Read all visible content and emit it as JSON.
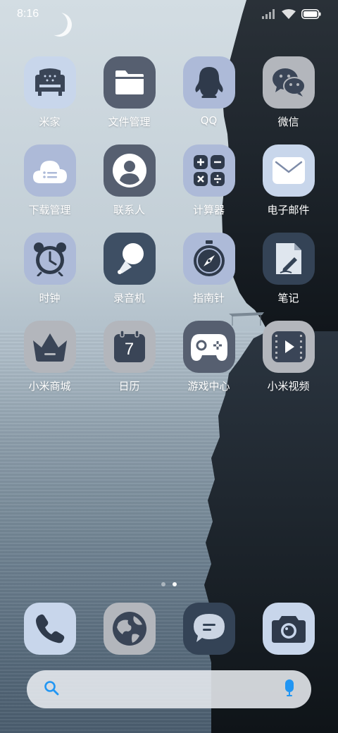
{
  "status_bar": {
    "time": "8:16",
    "icons": [
      "signal-icon",
      "wifi-icon",
      "battery-icon"
    ]
  },
  "apps": [
    {
      "label": "米家",
      "icon": "armchair-icon",
      "color": "#c8d6eb"
    },
    {
      "label": "文件管理",
      "icon": "folder-icon",
      "color": "#565f70"
    },
    {
      "label": "QQ",
      "icon": "penguin-icon",
      "color": "#adbad8"
    },
    {
      "label": "微信",
      "icon": "chat-bubbles-icon",
      "color": "#b3b6bc"
    },
    {
      "label": "下载管理",
      "icon": "cloud-list-icon",
      "color": "#adbad8"
    },
    {
      "label": "联系人",
      "icon": "person-icon",
      "color": "#565f70"
    },
    {
      "label": "计算器",
      "icon": "calculator-icon",
      "color": "#adbad8"
    },
    {
      "label": "电子邮件",
      "icon": "envelope-icon",
      "color": "#c8d6eb"
    },
    {
      "label": "时钟",
      "icon": "alarm-clock-icon",
      "color": "#adbad8"
    },
    {
      "label": "录音机",
      "icon": "microphone-icon",
      "color": "#3e4f64"
    },
    {
      "label": "指南针",
      "icon": "compass-icon",
      "color": "#adbad8"
    },
    {
      "label": "笔记",
      "icon": "note-pen-icon",
      "color": "#344356"
    },
    {
      "label": "小米商城",
      "icon": "shop-basket-icon",
      "color": "#b3b6bc"
    },
    {
      "label": "日历",
      "icon": "calendar-icon",
      "color": "#b3b6bc",
      "date": "7"
    },
    {
      "label": "游戏中心",
      "icon": "gamepad-icon",
      "color": "#565f70"
    },
    {
      "label": "小米视频",
      "icon": "video-play-icon",
      "color": "#b3b6bc"
    }
  ],
  "page_indicator": {
    "count": 2,
    "active_index": 1
  },
  "dock": [
    {
      "name": "phone",
      "icon": "phone-icon",
      "color": "#c8d6eb"
    },
    {
      "name": "browser",
      "icon": "globe-icon",
      "color": "#b3b6bc"
    },
    {
      "name": "messages",
      "icon": "message-bubble-icon",
      "color": "#344356"
    },
    {
      "name": "camera",
      "icon": "camera-icon",
      "color": "#c8d6eb"
    }
  ],
  "search": {
    "placeholder": "",
    "value": "",
    "accent_color": "#2196f3"
  }
}
